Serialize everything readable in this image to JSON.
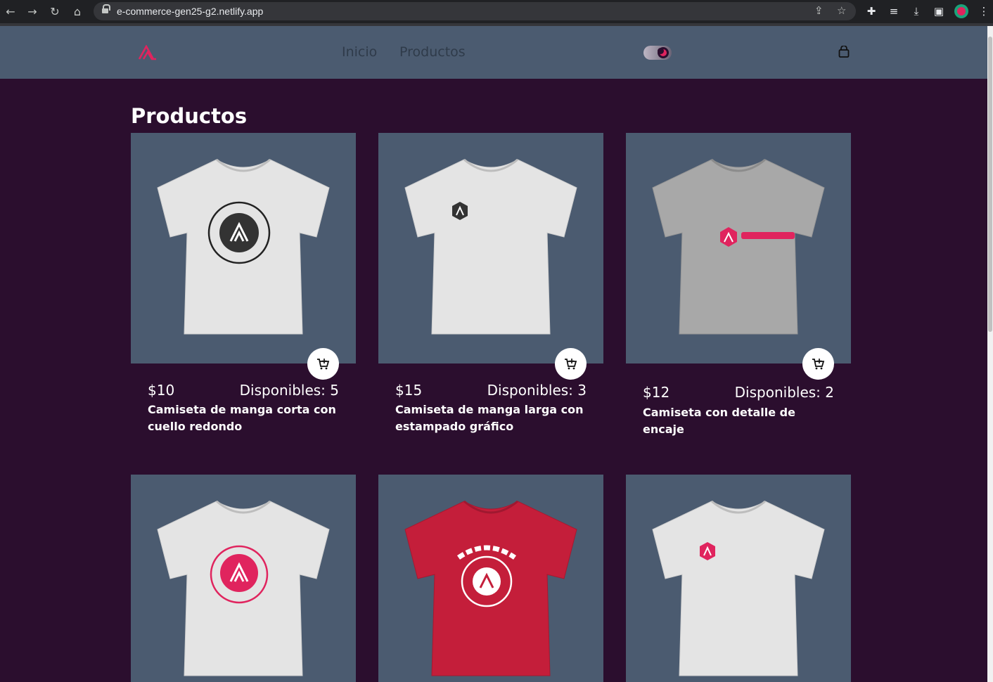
{
  "browser": {
    "url": "e-commerce-gen25-g2.netlify.app"
  },
  "header": {
    "nav": [
      "Inicio",
      "Productos"
    ]
  },
  "colors": {
    "page_bg": "#2b0e2e",
    "header_bg": "#4b5b70",
    "card_bg": "#4b5b70",
    "accent": "#e0245e"
  },
  "page": {
    "title": "Productos"
  },
  "products": [
    {
      "price": "$10",
      "stock": "Disponibles: 5",
      "name": "Camiseta de manga corta con cuello redondo",
      "shirt_color": "#e4e4e4",
      "print": "dark-badge-circle"
    },
    {
      "price": "$15",
      "stock": "Disponibles: 3",
      "name": "Camiseta de manga larga con estampado gráfico",
      "shirt_color": "#e4e4e4",
      "print": "small-dark-logo"
    },
    {
      "price": "$12",
      "stock": "Disponibles: 2",
      "name": "Camiseta con detalle de encaje",
      "shirt_color": "#a8a8a8",
      "print": "pink-wordmark"
    },
    {
      "shirt_color": "#e4e4e4",
      "print": "pink-badge-circle"
    },
    {
      "shirt_color": "#c41e3a",
      "print": "white-academlo-badge"
    },
    {
      "shirt_color": "#e4e4e4",
      "print": "small-pink-logo"
    }
  ],
  "icons": {
    "add_to_cart": "cart-plus-icon",
    "cart": "shopping-bag-icon",
    "theme_toggle": "moon-icon",
    "logo": "academlo-logo"
  }
}
